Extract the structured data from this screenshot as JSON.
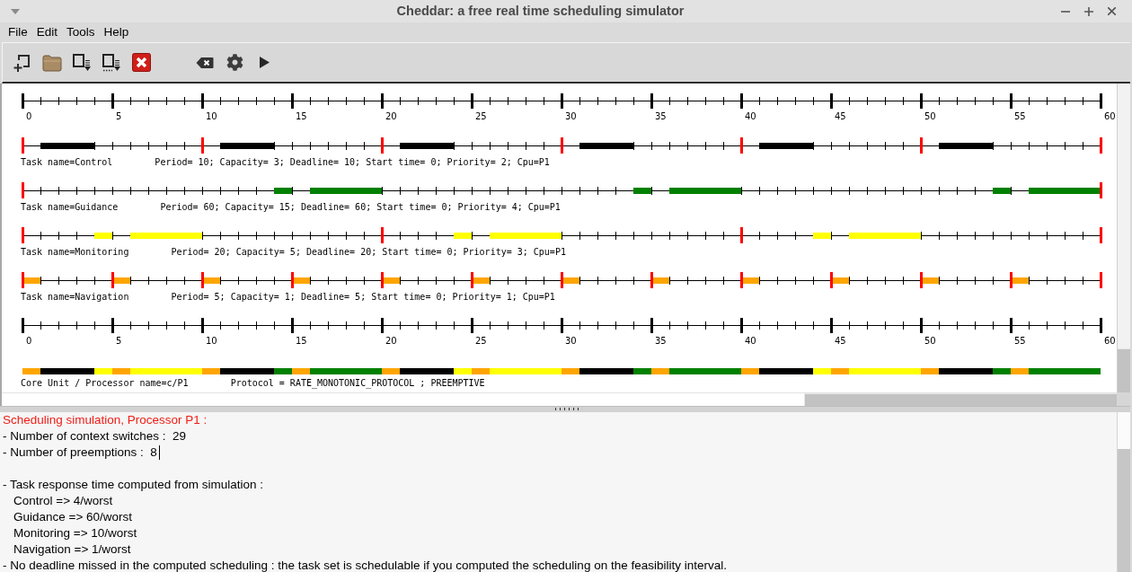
{
  "window": {
    "title": "Cheddar: a free real time scheduling simulator"
  },
  "menu_bar": [
    "File",
    "Edit",
    "Tools",
    "Help"
  ],
  "schedule": {
    "top_axis": {
      "labels": [
        "0",
        "5",
        "10",
        "15",
        "20",
        "25",
        "30",
        "35",
        "40",
        "45",
        "50",
        "55",
        "60"
      ]
    },
    "tasks": [
      {
        "name": "Task name=Control",
        "parameters": "Period= 10; Capacity= 3; Deadline= 10; Start time= 0; Priority= 2; Cpu=P1",
        "color": "#000000",
        "running": [
          false,
          true,
          true,
          true,
          false,
          false,
          false,
          false,
          false,
          false,
          false,
          true,
          true,
          true,
          false,
          false,
          false,
          false,
          false,
          false,
          false,
          true,
          true,
          true,
          false,
          false,
          false,
          false,
          false,
          false,
          false,
          true,
          true,
          true,
          false,
          false,
          false,
          false,
          false,
          false,
          false,
          true,
          true,
          true,
          false,
          false,
          false,
          false,
          false,
          false,
          false,
          true,
          true,
          true,
          false,
          false,
          false,
          false,
          false,
          false
        ],
        "released": [
          true,
          false,
          false,
          false,
          false,
          false,
          false,
          false,
          false,
          false,
          true,
          false,
          false,
          false,
          false,
          false,
          false,
          false,
          false,
          false,
          true,
          false,
          false,
          false,
          false,
          false,
          false,
          false,
          false,
          false,
          true,
          false,
          false,
          false,
          false,
          false,
          false,
          false,
          false,
          false,
          true,
          false,
          false,
          false,
          false,
          false,
          false,
          false,
          false,
          false,
          true,
          false,
          false,
          false,
          false,
          false,
          false,
          false,
          false,
          false,
          true
        ]
      },
      {
        "name": "Task name=Guidance",
        "parameters": "Period= 60; Capacity= 15; Deadline= 60; Start time= 0; Priority= 4; Cpu=P1",
        "color": "#008000",
        "running": [
          false,
          false,
          false,
          false,
          false,
          false,
          false,
          false,
          false,
          false,
          false,
          false,
          false,
          false,
          true,
          false,
          true,
          true,
          true,
          true,
          false,
          false,
          false,
          false,
          false,
          false,
          false,
          false,
          false,
          false,
          false,
          false,
          false,
          false,
          true,
          false,
          true,
          true,
          true,
          true,
          false,
          false,
          false,
          false,
          false,
          false,
          false,
          false,
          false,
          false,
          false,
          false,
          false,
          false,
          true,
          false,
          true,
          true,
          true,
          true
        ],
        "released": [
          true,
          false,
          false,
          false,
          false,
          false,
          false,
          false,
          false,
          false,
          false,
          false,
          false,
          false,
          false,
          false,
          false,
          false,
          false,
          false,
          false,
          false,
          false,
          false,
          false,
          false,
          false,
          false,
          false,
          false,
          false,
          false,
          false,
          false,
          false,
          false,
          false,
          false,
          false,
          false,
          false,
          false,
          false,
          false,
          false,
          false,
          false,
          false,
          false,
          false,
          false,
          false,
          false,
          false,
          false,
          false,
          false,
          false,
          false,
          false,
          true
        ]
      },
      {
        "name": "Task name=Monitoring",
        "parameters": "Period= 20; Capacity= 5; Deadline= 20; Start time= 0; Priority= 3; Cpu=P1",
        "color": "#ffff00",
        "running": [
          false,
          false,
          false,
          false,
          true,
          false,
          true,
          true,
          true,
          true,
          false,
          false,
          false,
          false,
          false,
          false,
          false,
          false,
          false,
          false,
          false,
          false,
          false,
          false,
          true,
          false,
          true,
          true,
          true,
          true,
          false,
          false,
          false,
          false,
          false,
          false,
          false,
          false,
          false,
          false,
          false,
          false,
          false,
          false,
          true,
          false,
          true,
          true,
          true,
          true,
          false,
          false,
          false,
          false,
          false,
          false,
          false,
          false,
          false,
          false
        ],
        "released": [
          true,
          false,
          false,
          false,
          false,
          false,
          false,
          false,
          false,
          false,
          false,
          false,
          false,
          false,
          false,
          false,
          false,
          false,
          false,
          false,
          true,
          false,
          false,
          false,
          false,
          false,
          false,
          false,
          false,
          false,
          false,
          false,
          false,
          false,
          false,
          false,
          false,
          false,
          false,
          false,
          true,
          false,
          false,
          false,
          false,
          false,
          false,
          false,
          false,
          false,
          false,
          false,
          false,
          false,
          false,
          false,
          false,
          false,
          false,
          false,
          true
        ]
      },
      {
        "name": "Task name=Navigation",
        "parameters": "Period= 5; Capacity= 1; Deadline= 5; Start time= 0; Priority= 1; Cpu=P1",
        "color": "#ffa500",
        "running": [
          true,
          false,
          false,
          false,
          false,
          true,
          false,
          false,
          false,
          false,
          true,
          false,
          false,
          false,
          false,
          true,
          false,
          false,
          false,
          false,
          true,
          false,
          false,
          false,
          false,
          true,
          false,
          false,
          false,
          false,
          true,
          false,
          false,
          false,
          false,
          true,
          false,
          false,
          false,
          false,
          true,
          false,
          false,
          false,
          false,
          true,
          false,
          false,
          false,
          false,
          true,
          false,
          false,
          false,
          false,
          true,
          false,
          false,
          false,
          false
        ],
        "released": [
          true,
          false,
          false,
          false,
          false,
          true,
          false,
          false,
          false,
          false,
          true,
          false,
          false,
          false,
          false,
          true,
          false,
          false,
          false,
          false,
          true,
          false,
          false,
          false,
          false,
          true,
          false,
          false,
          false,
          false,
          true,
          false,
          false,
          false,
          false,
          true,
          false,
          false,
          false,
          false,
          true,
          false,
          false,
          false,
          false,
          true,
          false,
          false,
          false,
          false,
          true,
          false,
          false,
          false,
          false,
          true,
          false,
          false,
          false,
          false,
          true
        ]
      }
    ],
    "bottom_axis": {
      "labels": [
        "0",
        "5",
        "10",
        "15",
        "20",
        "25",
        "30",
        "35",
        "40",
        "45",
        "50",
        "55",
        "60"
      ]
    },
    "processor": {
      "label": "Core Unit / Processor name=c/P1",
      "protocol": "Protocol = RATE_MONOTONIC_PROTOCOL ; PREEMPTIVE"
    }
  },
  "report": {
    "title": "Scheduling simulation, Processor P1 :",
    "sections": [
      {
        "lines": [
          {
            "text": "- Number of context switches :  29",
            "cursor": false
          },
          {
            "text": "- Number of preemptions :  8",
            "cursor": true
          }
        ]
      },
      {
        "lines": [
          {
            "text": "- Task response time computed from simulation :",
            "cursor": false,
            "children": [
              {
                "text": "Control => 4/worst",
                "cursor": false
              },
              {
                "text": "Guidance => 60/worst",
                "cursor": false
              },
              {
                "text": "Monitoring => 10/worst",
                "cursor": false
              },
              {
                "text": "Navigation => 1/worst",
                "cursor": false
              }
            ]
          },
          {
            "text": "- No deadline missed in the computed scheduling : the task set is schedulable if you computed the scheduling on the feasibility interval.",
            "cursor": false
          }
        ]
      }
    ]
  }
}
